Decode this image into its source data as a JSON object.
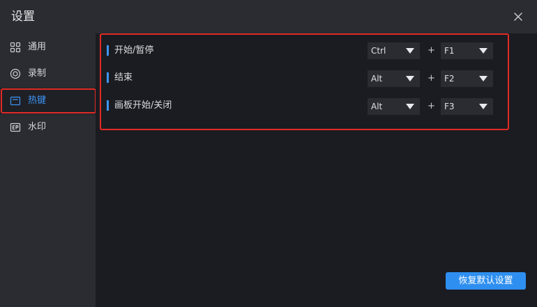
{
  "window": {
    "title": "设置"
  },
  "sidebar": {
    "items": [
      {
        "label": "通用",
        "icon": "grid-icon"
      },
      {
        "label": "录制",
        "icon": "record-icon"
      },
      {
        "label": "热键",
        "icon": "keyboard-icon",
        "active": true
      },
      {
        "label": "水印",
        "icon": "watermark-icon"
      }
    ]
  },
  "hotkeys": [
    {
      "name": "开始/暂停",
      "modifier": "Ctrl",
      "plus": "+",
      "key": "F1"
    },
    {
      "name": "结束",
      "modifier": "Alt",
      "plus": "+",
      "key": "F2"
    },
    {
      "name": "画板开始/关闭",
      "modifier": "Alt",
      "plus": "+",
      "key": "F3"
    }
  ],
  "footer": {
    "reset_label": "恢复默认设置"
  },
  "colors": {
    "accent": "#3d95f5",
    "button": "#2f8ff0",
    "highlight": "#e22a25",
    "panel": "#2a2c32",
    "background": "#1b1c21"
  }
}
